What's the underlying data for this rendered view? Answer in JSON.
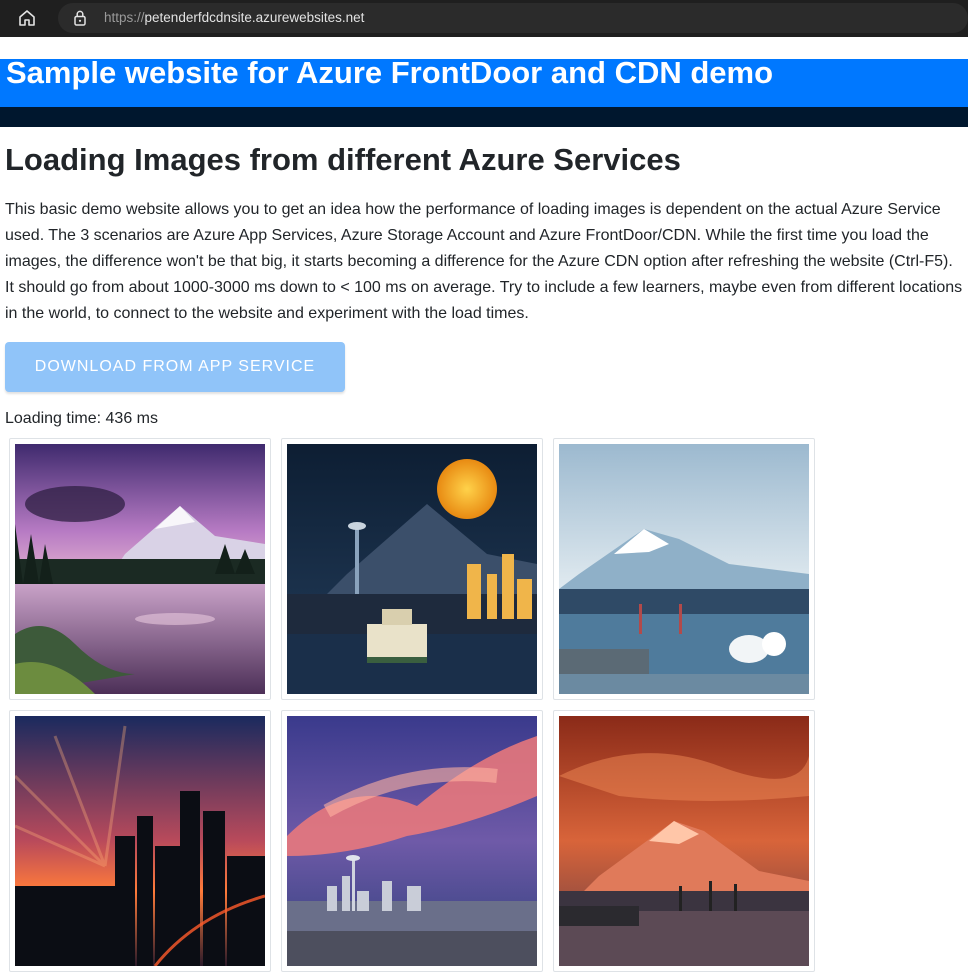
{
  "browser": {
    "url_scheme": "https://",
    "url_host": "petenderfdcdnsite.azurewebsites.net"
  },
  "header": {
    "title": "Sample website for Azure FrontDoor and CDN demo"
  },
  "main": {
    "heading": "Loading Images from different Azure Services",
    "intro": "This basic demo website allows you to get an idea how the performance of loading images is dependent on the actual Azure Service used. The 3 scenarios are Azure App Services, Azure Storage Account and Azure FrontDoor/CDN. While the first time you load the images, the difference won't be that big, it starts becoming a difference for the Azure CDN option after refreshing the website (Ctrl-F5). It should go from about 1000-3000 ms down to < 100 ms on average. Try to include a few learners, maybe even from different locations in the world, to connect to the website and experiment with the load times.",
    "download_button_label": "DOWNLOAD FROM APP SERVICE",
    "loading_time_label": "Loading time:",
    "loading_time_value": "436 ms"
  },
  "colors": {
    "banner": "#0078ff",
    "banner_dark": "#00172e",
    "button": "#90c4f9"
  },
  "gallery": [
    {
      "subject": "mountain lake at sunset"
    },
    {
      "subject": "full moon over city skyline and ferry"
    },
    {
      "subject": "snow mountain over harbor"
    },
    {
      "subject": "city skyline sunset rays"
    },
    {
      "subject": "pink clouds over city skyline"
    },
    {
      "subject": "red mountain over water"
    }
  ]
}
